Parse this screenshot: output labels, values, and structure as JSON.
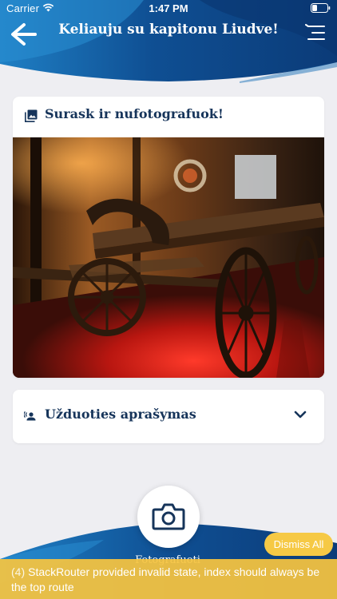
{
  "status_bar": {
    "carrier": "Carrier",
    "time": "1:47 PM"
  },
  "header": {
    "title": "Keliauju su kapitonu Liudve!",
    "back_icon": "arrow-left-icon",
    "menu_icon": "menu-icon"
  },
  "photo_card": {
    "icon": "photo-library-icon",
    "title": "Surask ir nufotografuok!",
    "image": "old wooden cart under red light in museum"
  },
  "description_card": {
    "icon": "speaker-person-icon",
    "title": "Užduoties aprašymas",
    "expand_icon": "chevron-down-icon"
  },
  "camera": {
    "icon": "camera-icon",
    "label": "Fotografuoti"
  },
  "warning": {
    "dismiss_label": "Dismiss All",
    "count": "(4)",
    "message": "StackRouter provided invalid state, index should always be the top route"
  },
  "colors": {
    "brand_dark": "#0b3d7a",
    "brand_mid": "#1c72b8",
    "brand_light": "#3a9ad9",
    "text": "#16345a",
    "warning": "#f6c945",
    "background": "#eeeef2"
  }
}
